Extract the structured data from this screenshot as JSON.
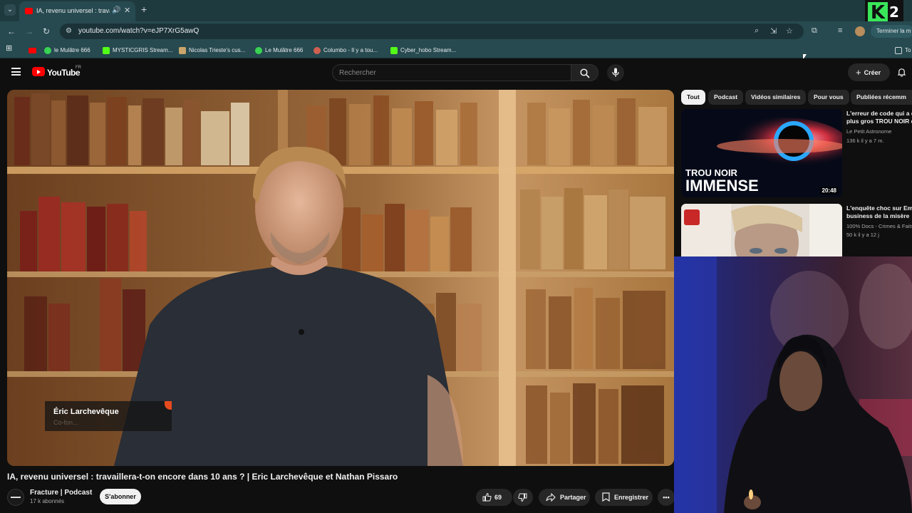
{
  "browser": {
    "tab_title": "IA, revenu universel : travailler",
    "url": "youtube.com/watch?v=eJP7XrG5awQ",
    "finish_label": "Terminer la m",
    "bookmarks": [
      {
        "label": "le Mulâtre 666",
        "color": "#39d353"
      },
      {
        "label": "MYSTICGRIS Stream...",
        "color": "#53fc18"
      },
      {
        "label": "Nicolas Trieste's cus...",
        "color": "#c9a46b"
      },
      {
        "label": "Le Mulâtre 666",
        "color": "#39d353"
      },
      {
        "label": "Columbo - Il y a tou...",
        "color": "#d06050"
      },
      {
        "label": "Cyber_hobo Stream...",
        "color": "#53fc18"
      }
    ],
    "bookmarks_overflow": "To"
  },
  "overlay_logo": {
    "letter": "K",
    "number": "2",
    "accent": "#39e65a"
  },
  "youtube": {
    "logo_text": "YouTube",
    "country_code": "FR",
    "search_placeholder": "Rechercher",
    "create_label": "Créer",
    "brand_color": "#ff0000"
  },
  "video": {
    "caption_name": "Éric Larchevêque",
    "caption_role": "Co-fon...",
    "title": "IA, revenu universel : travaillera-t-on encore dans 10 ans ? | Eric Larchevêque et Nathan Pissaro",
    "channel": "Fracture | Podcast",
    "subscribers": "17 k abonnés",
    "subscribe_label": "S'abonner",
    "likes": "69",
    "share_label": "Partager",
    "save_label": "Enregistrer"
  },
  "chips": [
    {
      "label": "Tout",
      "active": true
    },
    {
      "label": "Podcast",
      "active": false
    },
    {
      "label": "Vidéos similaires",
      "active": false
    },
    {
      "label": "Pour vous",
      "active": false
    },
    {
      "label": "Publiées récemm",
      "active": false
    }
  ],
  "recommendations": [
    {
      "title_line1": "L'erreur de code qui a d",
      "title_line2": "plus gros TROU NOIR de",
      "channel": "Le Petit Astronome",
      "meta": "136 k  il y a 7 m.",
      "duration": "20:48",
      "thumb_text_1": "TROU NOIR",
      "thumb_text_2": "IMMENSE"
    },
    {
      "title_line1": "L'enquête choc sur Emn",
      "title_line2": "business de la misère",
      "channel": "100% Docs - Crimes & Faits",
      "meta": "50 k  il y a 12 j"
    }
  ]
}
